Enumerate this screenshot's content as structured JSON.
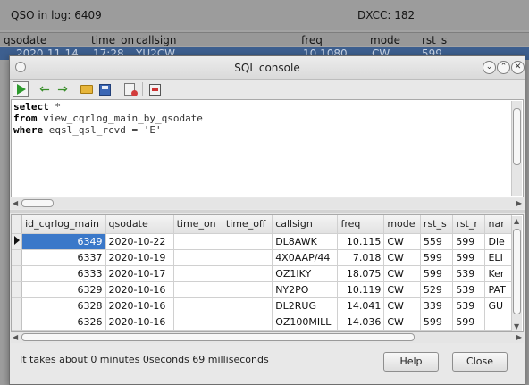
{
  "background": {
    "qso_in_log": "QSO in log:   6409",
    "dxcc": "DXCC:   182",
    "columns": [
      "qsodate",
      "time_on",
      "callsign",
      "freq",
      "mode",
      "rst_s"
    ],
    "selected_row": [
      "2020-11-14",
      "17:28",
      "YU2CW",
      "10.1080",
      "CW",
      "599"
    ]
  },
  "dialog": {
    "title": "SQL console",
    "query_lines": [
      {
        "kw": "select",
        "rest": " *"
      },
      {
        "kw": "from",
        "rest": " view_cqrlog_main_by_qsodate"
      },
      {
        "kw": "where",
        "rest": " eqsl_qsl_rcvd = 'E'"
      }
    ],
    "table": {
      "columns": [
        "id_cqrlog_main",
        "qsodate",
        "time_on",
        "time_off",
        "callsign",
        "freq",
        "mode",
        "rst_s",
        "rst_r",
        "nar"
      ],
      "rows": [
        [
          "6349",
          "2020-10-22",
          "",
          "",
          "DL8AWK",
          "10.115",
          "CW",
          "559",
          "599",
          "Die"
        ],
        [
          "6337",
          "2020-10-19",
          "",
          "",
          "4X0AAP/44",
          "7.018",
          "CW",
          "599",
          "599",
          "ELI"
        ],
        [
          "6333",
          "2020-10-17",
          "",
          "",
          "OZ1IKY",
          "18.075",
          "CW",
          "599",
          "539",
          "Ker"
        ],
        [
          "6329",
          "2020-10-16",
          "",
          "",
          "NY2PO",
          "10.119",
          "CW",
          "529",
          "539",
          "PAT"
        ],
        [
          "6328",
          "2020-10-16",
          "",
          "",
          "DL2RUG",
          "14.041",
          "CW",
          "339",
          "539",
          "GU"
        ],
        [
          "6326",
          "2020-10-16",
          "",
          "",
          "OZ100MILL",
          "14.036",
          "CW",
          "599",
          "599",
          ""
        ]
      ]
    },
    "status_text": "It takes about 0 minutes 0seconds 69 milliseconds",
    "help_label": "Help",
    "close_label": "Close"
  }
}
